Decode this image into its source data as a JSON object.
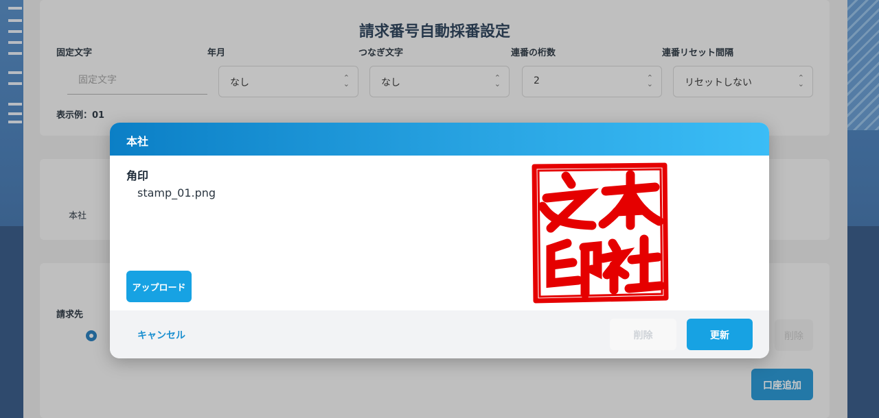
{
  "settings": {
    "title": "請求番号自動採番設定",
    "fields": {
      "fixed_text_label": "固定文字",
      "fixed_text_placeholder": "固定文字",
      "year_month_label": "年月",
      "year_month_value": "なし",
      "connector_label": "つなぎ文字",
      "connector_value": "なし",
      "digits_label": "連番の桁数",
      "digits_value": "2",
      "reset_label": "連番リセット間隔",
      "reset_value": "リセットしない"
    },
    "example_label": "表示例：01"
  },
  "company_section": {
    "label": "本社"
  },
  "billing_section": {
    "label": "請求先",
    "delete_label": "削除",
    "add_account_label": "口座追加"
  },
  "dialog": {
    "title": "本社",
    "stamp_type_label": "角印",
    "file_name": "stamp_01.png",
    "stamp_text": "本社之印",
    "upload_label": "アップロード",
    "cancel_label": "キャンセル",
    "delete_label": "削除",
    "update_label": "更新"
  },
  "colors": {
    "accent": "#17a2e3",
    "header_gradient_start": "#0b7fc6",
    "header_gradient_end": "#3bbdf6",
    "stamp_red": "#e50000"
  },
  "icons": {
    "select_chevron": "chevron-up-down-icon",
    "radio": "radio-selected-icon"
  }
}
